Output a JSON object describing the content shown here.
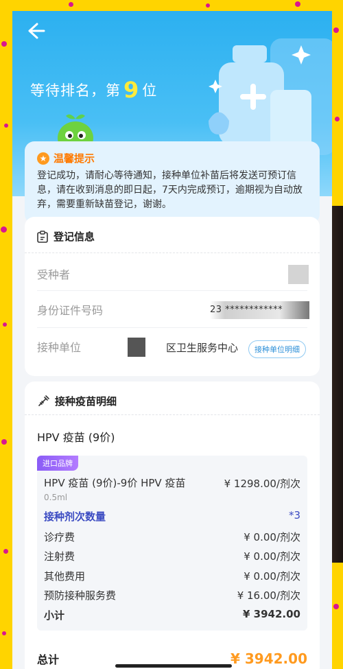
{
  "colors": {
    "frame_bg": "#ffd400",
    "dot": "#d9168f",
    "hero_top": "#2cb0f0",
    "hero_bottom": "#8ed8fb",
    "rank_number": "#ffeb3b",
    "accent_orange": "#ff9a1f",
    "accent_purple": "#3b4bc2",
    "link_blue": "#2c8fd8"
  },
  "header": {
    "back_icon": "arrow-left-icon",
    "rank_prefix": "等待排名，第",
    "rank_number": "9",
    "rank_suffix": "位"
  },
  "tip": {
    "icon": "star-icon",
    "title": "温馨提示",
    "text": "登记成功，请耐心等待通知，接种单位补苗后将发送可预订信息，请在收到消息的即日起，7天内完成预订，逾期视为自动放弃，需要重新缺苗登记，谢谢。"
  },
  "registration": {
    "icon": "clipboard-icon",
    "title": "登记信息",
    "rows": [
      {
        "label": "受种者",
        "value": ""
      },
      {
        "label": "身份证件号码",
        "value": "23 ************"
      },
      {
        "label": "接种单位",
        "value": "区卫生服务中心"
      }
    ],
    "unit_detail_button": "接种单位明细"
  },
  "vaccine_detail": {
    "icon": "syringe-icon",
    "title": "接种疫苗明细",
    "vaccine_name": "HPV 疫苗 (9价)",
    "badge": "进口品牌",
    "item_name": "HPV 疫苗 (9价)-9价 HPV 疫苗",
    "item_volume": "0.5ml",
    "item_price": "¥ 1298.00/剂次",
    "dose_label": "接种剂次数量",
    "dose_value": "*3",
    "fees": [
      {
        "label": "诊疗费",
        "value": "¥ 0.00/剂次"
      },
      {
        "label": "注射费",
        "value": "¥ 0.00/剂次"
      },
      {
        "label": "其他费用",
        "value": "¥ 0.00/剂次"
      },
      {
        "label": "预防接种服务费",
        "value": "¥ 16.00/剂次"
      }
    ],
    "subtotal_label": "小计",
    "subtotal_value": "¥ 3942.00",
    "total_label": "总计",
    "total_value": "¥ 3942.00"
  }
}
